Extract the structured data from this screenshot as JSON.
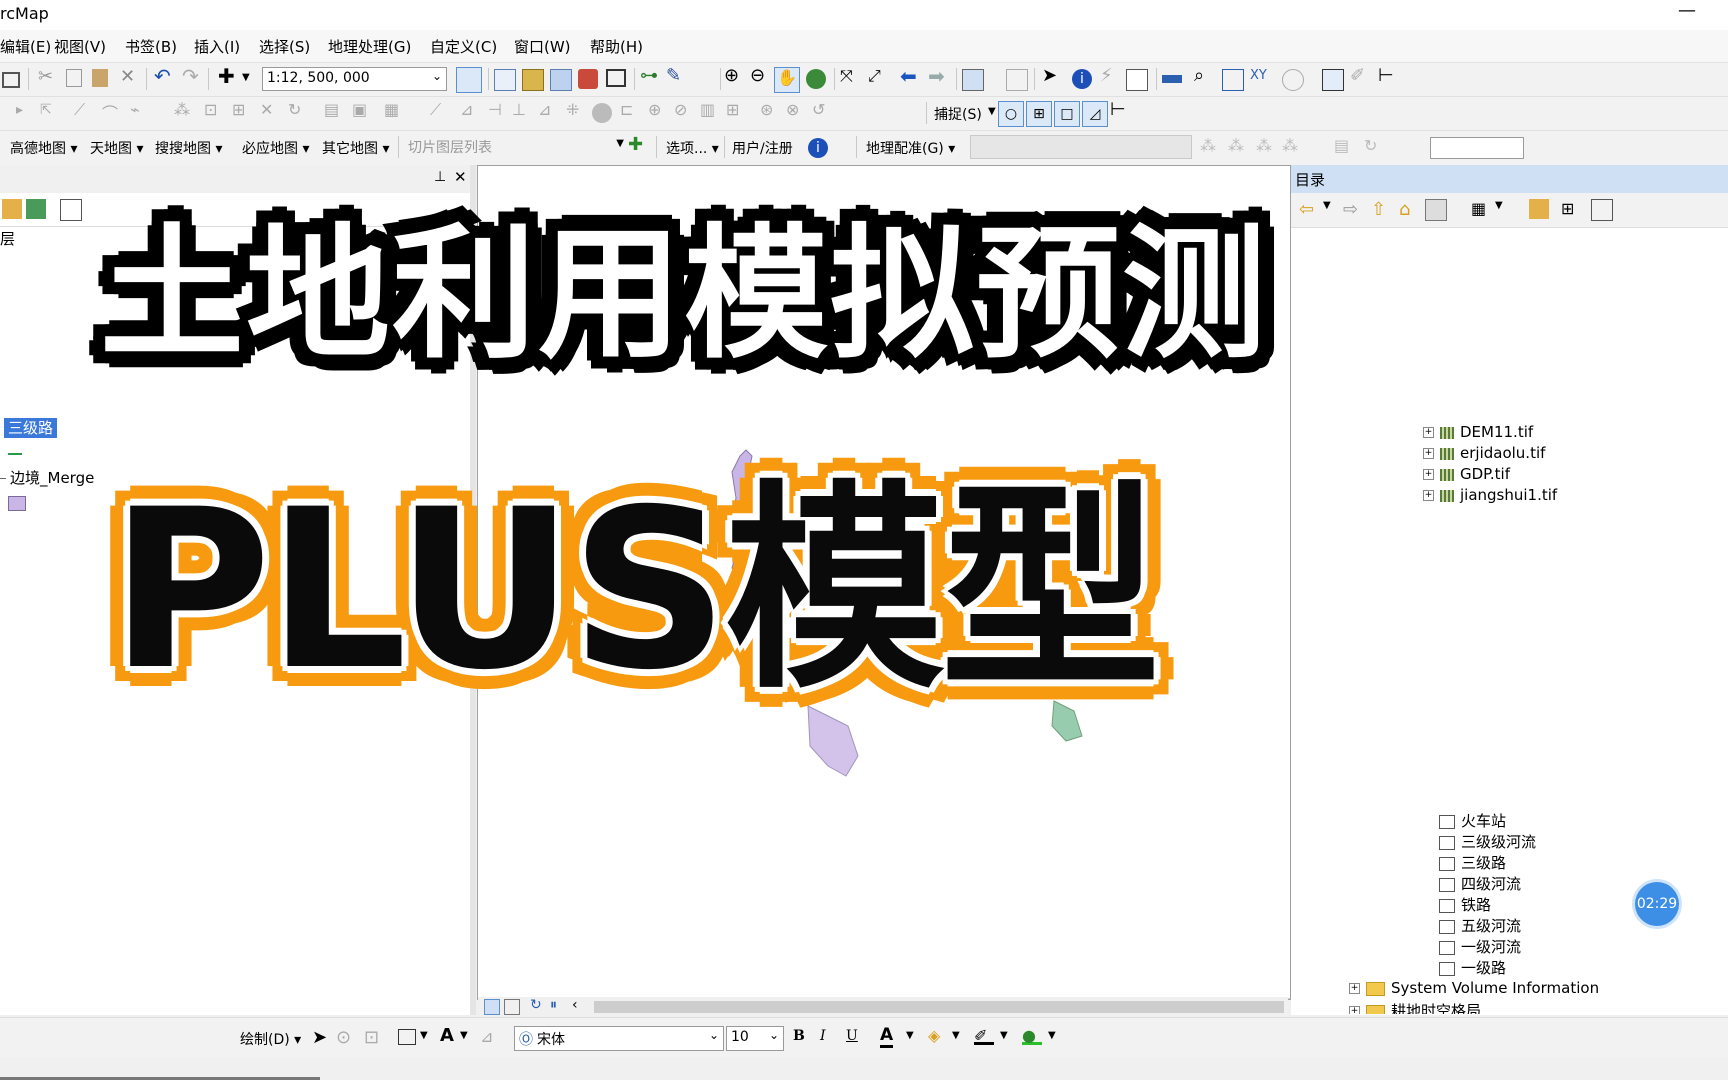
{
  "window": {
    "title": "rcMap",
    "minimize": "—"
  },
  "menu": [
    "编辑(E)",
    "视图(V)",
    "书签(B)",
    "插入(I)",
    "选择(S)",
    "地理处理(G)",
    "自定义(C)",
    "窗口(W)",
    "帮助(H)"
  ],
  "toolbar1": {
    "scale_value": "1:12, 500, 000"
  },
  "toolbar2": {
    "snap_label": "捕捉(S)"
  },
  "toolbar3": {
    "map_menus": [
      "高德地图",
      "天地图",
      "搜搜地图",
      "必应地图",
      "其它地图"
    ],
    "tile_list_placeholder": "切片图层列表",
    "options_label": "选项...",
    "user_label": "用户/注册",
    "georef_label": "地理配准(G)"
  },
  "toc": {
    "header_label": "层",
    "items": [
      {
        "label": "三级路",
        "selected": true
      },
      {
        "label": "边境_Merge"
      }
    ]
  },
  "catalog": {
    "title": "目录",
    "rasters": [
      "DEM11.tif",
      "erjidaolu.tif",
      "GDP.tif",
      "jiangshui1.tif"
    ],
    "layers": [
      "火车站",
      "三级级河流",
      "三级路",
      "四级河流",
      "铁路",
      "五级河流",
      "一级河流",
      "一级路"
    ],
    "folders": [
      "System Volume Information",
      "耕地时空格局"
    ]
  },
  "drawing_toolbar": {
    "draw_label": "绘制(D)",
    "font": "宋体",
    "font_size": "10",
    "bold": "B",
    "italic": "I",
    "underline": "U",
    "font_color_icon": "A"
  },
  "overlay": {
    "title_line1": "土地利用模拟预测",
    "title_line2": "PLUS模型",
    "title_colors": {
      "fill1": "#ffffff",
      "outline1": "#000000",
      "fill2": "#0a0a0a",
      "outline2": "#f79a0f"
    }
  },
  "timer": "02:29"
}
